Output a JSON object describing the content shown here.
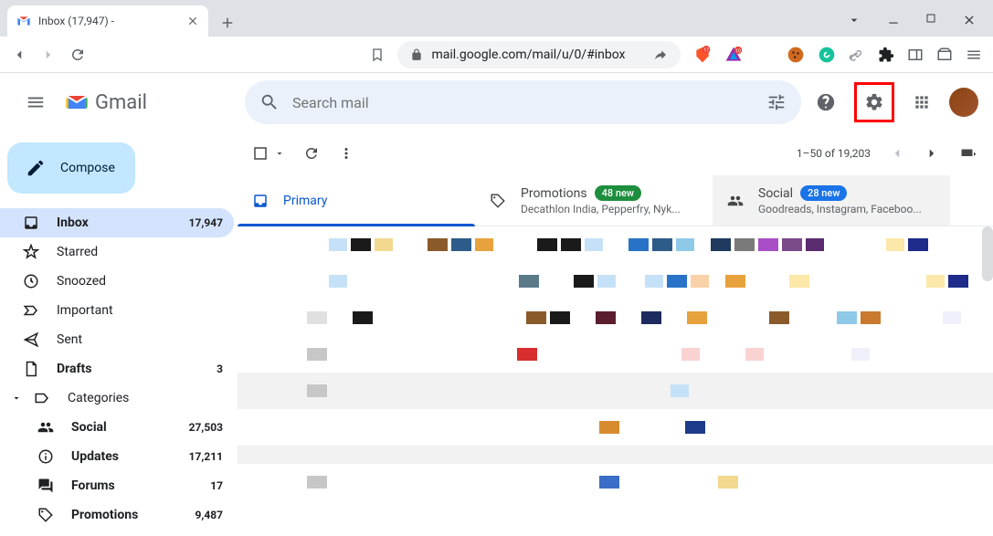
{
  "browser": {
    "tab_title": "Inbox (17,947) - ",
    "url": "mail.google.com/mail/u/0/#inbox"
  },
  "header": {
    "logo_text": "Gmail",
    "search_placeholder": "Search mail"
  },
  "compose_label": "Compose",
  "sidebar": {
    "items": [
      {
        "label": "Inbox",
        "count": "17,947",
        "active": true,
        "bold": true
      },
      {
        "label": "Starred",
        "count": ""
      },
      {
        "label": "Snoozed",
        "count": ""
      },
      {
        "label": "Important",
        "count": ""
      },
      {
        "label": "Sent",
        "count": ""
      },
      {
        "label": "Drafts",
        "count": "3",
        "bold": true
      }
    ],
    "categories_label": "Categories",
    "categories": [
      {
        "label": "Social",
        "count": "27,503",
        "bold": true
      },
      {
        "label": "Updates",
        "count": "17,211",
        "bold": true
      },
      {
        "label": "Forums",
        "count": "17",
        "bold": true
      },
      {
        "label": "Promotions",
        "count": "9,487",
        "bold": true
      }
    ]
  },
  "toolbar": {
    "pagination": "1–50 of 19,203"
  },
  "tabs": [
    {
      "label": "Primary",
      "badge": "",
      "subtitle": "",
      "active": true
    },
    {
      "label": "Promotions",
      "badge": "48 new",
      "subtitle": "Decathlon India, Pepperfry, Nyk..."
    },
    {
      "label": "Social",
      "badge": "28 new",
      "subtitle": "Goodreads, Instagram, Faceboo...",
      "hover": true
    }
  ]
}
